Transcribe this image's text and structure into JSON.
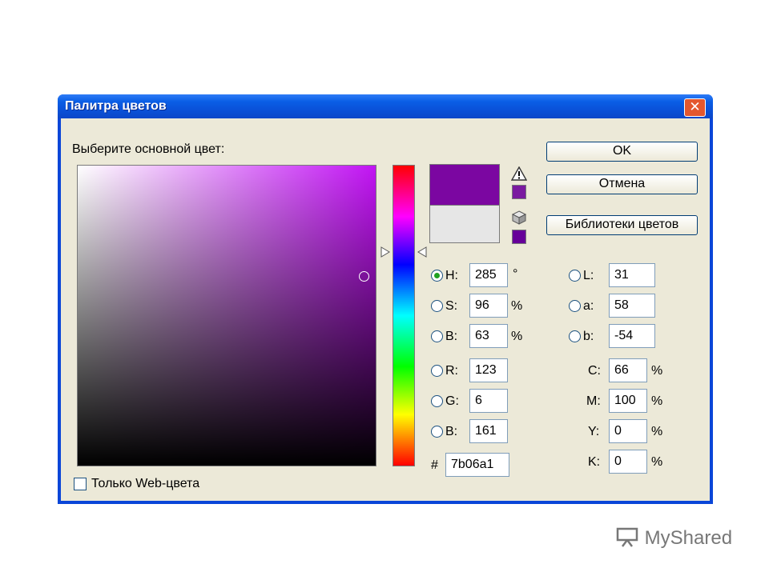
{
  "window": {
    "title": "Палитра цветов",
    "close_glyph": "✕"
  },
  "prompt_label": "Выберите основной цвет:",
  "buttons": {
    "ok": "OK",
    "cancel": "Отмена",
    "libraries": "Библиотеки цветов"
  },
  "colors": {
    "new": "#7b06a1",
    "old": "#e6e6e6",
    "gamut_warning": "#7a1aa0",
    "websafe_warning": "#660099"
  },
  "hsb": [
    {
      "label": "H:",
      "value": "285",
      "unit": "°",
      "selected": true
    },
    {
      "label": "S:",
      "value": "96",
      "unit": "%",
      "selected": false
    },
    {
      "label": "B:",
      "value": "63",
      "unit": "%",
      "selected": false
    }
  ],
  "rgb": [
    {
      "label": "R:",
      "value": "123"
    },
    {
      "label": "G:",
      "value": "6"
    },
    {
      "label": "B:",
      "value": "161"
    }
  ],
  "lab": [
    {
      "label": "L:",
      "value": "31"
    },
    {
      "label": "a:",
      "value": "58"
    },
    {
      "label": "b:",
      "value": "-54"
    }
  ],
  "cmyk": [
    {
      "label": "C:",
      "value": "66",
      "unit": "%"
    },
    {
      "label": "M:",
      "value": "100",
      "unit": "%"
    },
    {
      "label": "Y:",
      "value": "0",
      "unit": "%"
    },
    {
      "label": "K:",
      "value": "0",
      "unit": "%"
    }
  ],
  "hex": {
    "label": "#",
    "value": "7b06a1"
  },
  "web_only": {
    "label": "Только Web-цвета",
    "checked": false
  },
  "icons": {
    "gamut": "warning-triangle-icon",
    "websafe": "cube-icon",
    "logo": "presentation-board-icon"
  },
  "watermark": "MyShared"
}
